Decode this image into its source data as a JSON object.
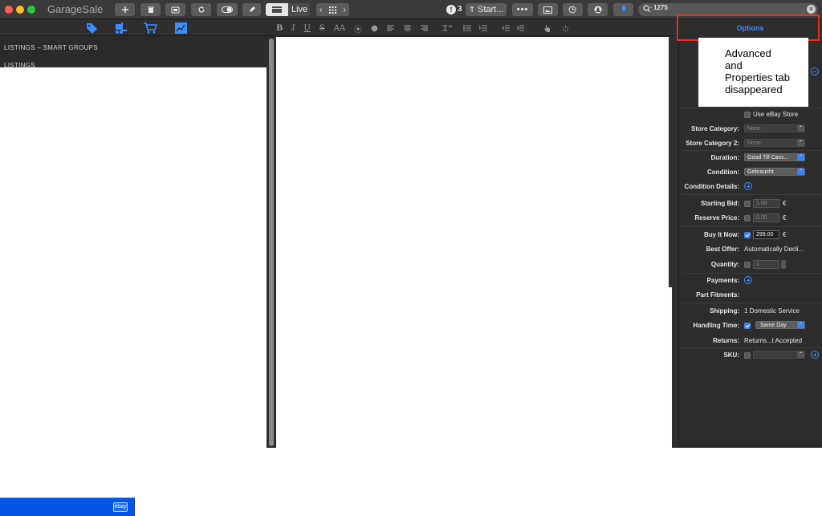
{
  "app": {
    "title": "GarageSale"
  },
  "toolbar": {
    "alert_count": "3",
    "start_label": "Start...",
    "live_label": "Live",
    "search_value": "1275",
    "search_clear": "×"
  },
  "left": {
    "section1": "LISTINGS – SMART GROUPS",
    "section2": "LISTINGS"
  },
  "format_tools": [
    "B",
    "I",
    "U",
    "S",
    "AA",
    "⦿",
    "●"
  ],
  "inspector": {
    "tab_label": "Options",
    "note_lines": [
      "Advanced",
      "and",
      "Properties tab",
      "disappeared"
    ],
    "use_ebay_store": "Use eBay Store",
    "store_category_label": "Store Category:",
    "store_category_value": "None",
    "store_category2_label": "Store Category 2:",
    "store_category2_value": "None",
    "duration_label": "Duration:",
    "duration_value": "Good Till Canc...",
    "condition_label": "Condition:",
    "condition_value": "Gebraucht",
    "condition_details_label": "Condition Details:",
    "starting_bid_label": "Starting Bid:",
    "starting_bid_value": "1.00",
    "reserve_price_label": "Reserve Price:",
    "reserve_price_value": "0.00",
    "buy_it_now_label": "Buy It Now:",
    "buy_it_now_value": "299.00",
    "currency": "€",
    "best_offer_label": "Best Offer:",
    "best_offer_value": "Automatically Decli...",
    "quantity_label": "Quantity:",
    "quantity_value": "1",
    "payments_label": "Payments:",
    "part_fitments_label": "Part Fitments:",
    "shipping_label": "Shipping:",
    "shipping_value": "1 Domestic Service",
    "handling_time_label": "Handling Time:",
    "handling_time_value": "Same Day",
    "returns_label": "Returns:",
    "returns_value": "Returns...t Accepted",
    "sku_label": "SKU:"
  },
  "taskbar": {
    "badge": "ebay"
  },
  "colors": {
    "accent": "#3b8cff",
    "annotation_red": "#e8321e",
    "taskbar_blue": "#0055e5"
  }
}
